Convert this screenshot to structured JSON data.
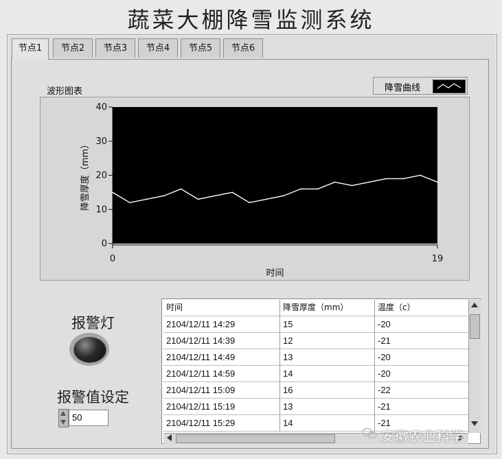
{
  "app": {
    "title": "蔬菜大棚降雪监测系统"
  },
  "tabs": [
    {
      "label": "节点1",
      "active": true
    },
    {
      "label": "节点2",
      "active": false
    },
    {
      "label": "节点3",
      "active": false
    },
    {
      "label": "节点4",
      "active": false
    },
    {
      "label": "节点5",
      "active": false
    },
    {
      "label": "节点6",
      "active": false
    }
  ],
  "waveform": {
    "label": "波形图表",
    "legend_label": "降雪曲线"
  },
  "chart_data": {
    "type": "line",
    "xlabel": "时间",
    "ylabel": "降雪厚度（mm）",
    "x": [
      0,
      1,
      2,
      3,
      4,
      5,
      6,
      7,
      8,
      9,
      10,
      11,
      12,
      13,
      14,
      15,
      16,
      17,
      18,
      19
    ],
    "series": [
      {
        "name": "降雪曲线",
        "values": [
          15,
          12,
          13,
          14,
          16,
          13,
          14,
          15,
          12,
          13,
          14,
          16,
          16,
          18,
          17,
          18,
          19,
          19,
          20,
          18
        ]
      }
    ],
    "xlim": [
      0,
      19
    ],
    "ylim": [
      0,
      40
    ],
    "x_ticks": [
      "0",
      "19"
    ],
    "y_ticks": [
      "40",
      "30",
      "20",
      "10",
      "0"
    ],
    "grid": false,
    "line_color": "#ffffff",
    "background_color": "#000000"
  },
  "alarm": {
    "lamp_label": "报警灯",
    "setting_label": "报警值设定",
    "setting_value": "50"
  },
  "table": {
    "headers": [
      "时间",
      "降雪厚度（mm）",
      "温度（c）"
    ],
    "rows": [
      [
        "2104/12/11 14:29",
        "15",
        "-20"
      ],
      [
        "2104/12/11 14:39",
        "12",
        "-21"
      ],
      [
        "2104/12/11 14:49",
        "13",
        "-20"
      ],
      [
        "2104/12/11 14:59",
        "14",
        "-20"
      ],
      [
        "2104/12/11 15:09",
        "16",
        "-22"
      ],
      [
        "2104/12/11 15:19",
        "13",
        "-21"
      ],
      [
        "2104/12/11 15:29",
        "14",
        "-21"
      ]
    ]
  },
  "watermark": {
    "text": "安徽农业科学",
    "icon": "wechat-icon"
  }
}
